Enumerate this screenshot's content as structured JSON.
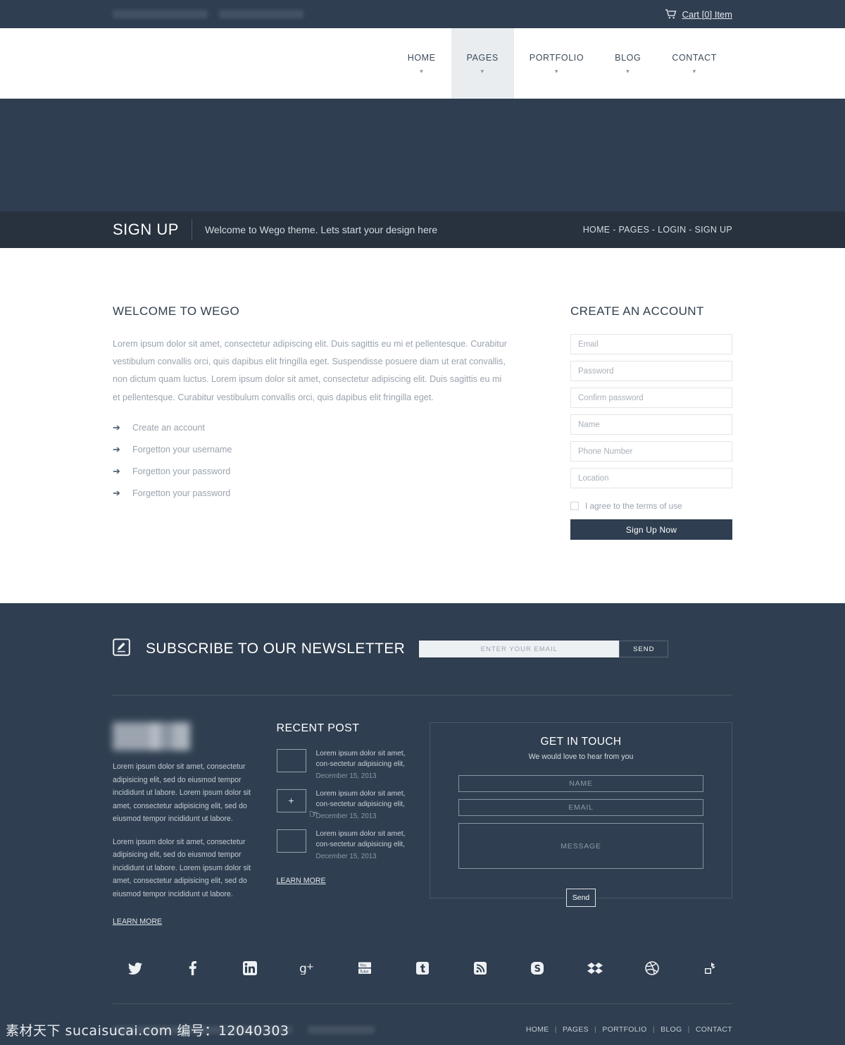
{
  "topbar": {
    "left_redacted_1": "",
    "left_redacted_2": "",
    "cart_label": "Cart [0] Item",
    "cart_icon": "shopping-cart-icon"
  },
  "header": {
    "logo_alt": "wego-logo",
    "nav": [
      {
        "label": "HOME",
        "active": false,
        "caret": "⌄"
      },
      {
        "label": "PAGES",
        "active": true,
        "caret": "⌄"
      },
      {
        "label": "PORTFOLIO",
        "active": false,
        "caret": "⌄"
      },
      {
        "label": "BLOG",
        "active": false,
        "caret": "⌄"
      },
      {
        "label": "CONTACT",
        "active": false,
        "caret": "⌄"
      }
    ]
  },
  "band": {
    "title": "SIGN UP",
    "subtitle": "Welcome to Wego theme. Lets start your design here",
    "breadcrumbs": "HOME -  PAGES  -  LOGIN  -  SIGN UP"
  },
  "main": {
    "left": {
      "heading": "WELCOME TO WEGO",
      "paragraph": "Lorem ipsum dolor sit amet, consectetur adipiscing elit. Duis sagittis eu mi et pellentesque. Curabitur vestibulum convallis orci, quis dapibus elit fringilla eget. Suspendisse posuere diam ut erat convallis, non dictum quam luctus. Lorem ipsum dolor sit amet, consectetur adipiscing elit. Duis sagittis eu mi et pellentesque. Curabitur vestibulum convallis orci, quis dapibus elit fringilla eget.",
      "links": [
        "Create an account",
        "Forgetton your username",
        "Forgetton your password",
        "Forgetton your password"
      ],
      "arrow_icon": "➔"
    },
    "right": {
      "heading": "CREATE AN ACCOUNT",
      "fields": [
        {
          "name": "email-field",
          "placeholder": "Email",
          "value": ""
        },
        {
          "name": "password-field",
          "placeholder": "Password",
          "value": ""
        },
        {
          "name": "confirm-password-field",
          "placeholder": "Confirm password",
          "value": ""
        },
        {
          "name": "name-field",
          "placeholder": "Name",
          "value": ""
        },
        {
          "name": "phone-number-field",
          "placeholder": "Phone Number",
          "value": ""
        },
        {
          "name": "location-field",
          "placeholder": "Location",
          "value": ""
        }
      ],
      "terms_label": "I agree to the terms of use",
      "terms_checked": false,
      "submit_label": "Sign Up Now"
    }
  },
  "newsletter": {
    "icon": "pencil-edit-icon",
    "title": "SUBSCRIBE TO OUR NEWSLETTER",
    "input_placeholder": "ENTER YOUR EMAIL",
    "input_value": "",
    "send_label": "SEND"
  },
  "footer": {
    "about": {
      "logo_alt": "wego-footer-logo",
      "paragraph_1": "Lorem ipsum dolor sit amet, consectetur adipisicing elit, sed do eiusmod tempor incididunt ut labore. Lorem ipsum dolor sit amet, consectetur adipisicing elit, sed do eiusmod tempor incididunt ut labore.",
      "paragraph_2": "Lorem ipsum dolor sit amet, consectetur adipisicing elit, sed do eiusmod tempor incididunt ut labore. Lorem ipsum dolor sit amet, consectetur adipisicing elit, sed do eiusmod tempor incididunt ut labore.",
      "learn_more": "LEARN MORE"
    },
    "recent_post": {
      "heading": "RECENT POST",
      "items": [
        {
          "text": "Lorem ipsum dolor sit amet, con-sectetur adipisicing elit,",
          "date": "December 15, 2013",
          "overlay": ""
        },
        {
          "text": "Lorem ipsum dolor sit amet, con-sectetur adipisicing elit,",
          "date": "December 15, 2013",
          "overlay": "+"
        },
        {
          "text": "Lorem ipsum dolor sit amet, con-sectetur adipisicing elit,",
          "date": "December 15, 2013",
          "overlay": ""
        }
      ],
      "learn_more": "LEARN MORE"
    },
    "get_in_touch": {
      "heading": "GET IN TOUCH",
      "subtitle": "We would love to hear from you",
      "name_placeholder": "NAME",
      "email_placeholder": "EMAIL",
      "message_placeholder": "MESSAGE",
      "send_label": "Send"
    },
    "socials": [
      {
        "name": "twitter-icon"
      },
      {
        "name": "facebook-icon"
      },
      {
        "name": "linkedin-icon"
      },
      {
        "name": "google-plus-icon"
      },
      {
        "name": "youtube-icon"
      },
      {
        "name": "tumblr-icon"
      },
      {
        "name": "rss-icon"
      },
      {
        "name": "skype-icon"
      },
      {
        "name": "dropbox-icon"
      },
      {
        "name": "dribbble-icon"
      },
      {
        "name": "forrst-icon"
      }
    ],
    "bottom_nav": [
      "HOME",
      "PAGES",
      "PORTFOLIO",
      "BLOG",
      "CONTACT"
    ],
    "bottom_separator": "|"
  },
  "watermark": {
    "text": "素材天下 sucaisucai.com  编号：12040303"
  },
  "colors": {
    "dark_navy": "#2f3e50",
    "band_navy": "#28323e",
    "accent_light": "#e9edf0",
    "body_text": "#9aa3ad",
    "heading": "#32404f"
  }
}
